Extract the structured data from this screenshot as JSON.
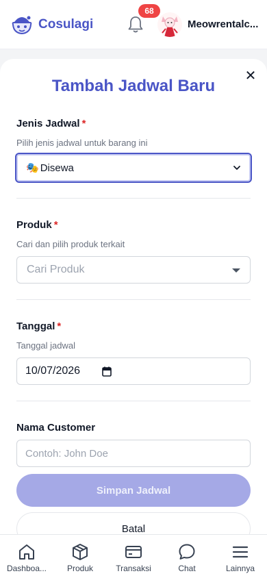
{
  "header": {
    "brand_name": "Cosulagi",
    "notification_count": "68",
    "username": "Meowrentalc..."
  },
  "modal": {
    "title": "Tambah Jadwal Baru",
    "close_symbol": "✕",
    "required_mark": "*",
    "schedule_type": {
      "label": "Jenis Jadwal",
      "hint": "Pilih jenis jadwal untuk barang ini",
      "selected_icon": "🎭",
      "selected_value": "Disewa"
    },
    "product": {
      "label": "Produk",
      "hint": "Cari dan pilih produk terkait",
      "placeholder": "Cari Produk"
    },
    "date": {
      "label": "Tanggal",
      "hint": "Tanggal jadwal",
      "value": "10/07/2026"
    },
    "customer": {
      "label": "Nama Customer",
      "placeholder": "Contoh: John Doe"
    },
    "save_label": "Simpan Jadwal",
    "cancel_label": "Batal"
  },
  "bottom_nav": {
    "items": [
      {
        "label": "Dashboa...",
        "icon": "home-icon"
      },
      {
        "label": "Produk",
        "icon": "box-icon"
      },
      {
        "label": "Transaksi",
        "icon": "card-icon"
      },
      {
        "label": "Chat",
        "icon": "chat-icon"
      },
      {
        "label": "Lainnya",
        "icon": "menu-icon"
      }
    ]
  },
  "colors": {
    "brand": "#4a55c6",
    "badge": "#ef4444",
    "required": "#dc2626",
    "primary_disabled": "#a5a9e6"
  }
}
